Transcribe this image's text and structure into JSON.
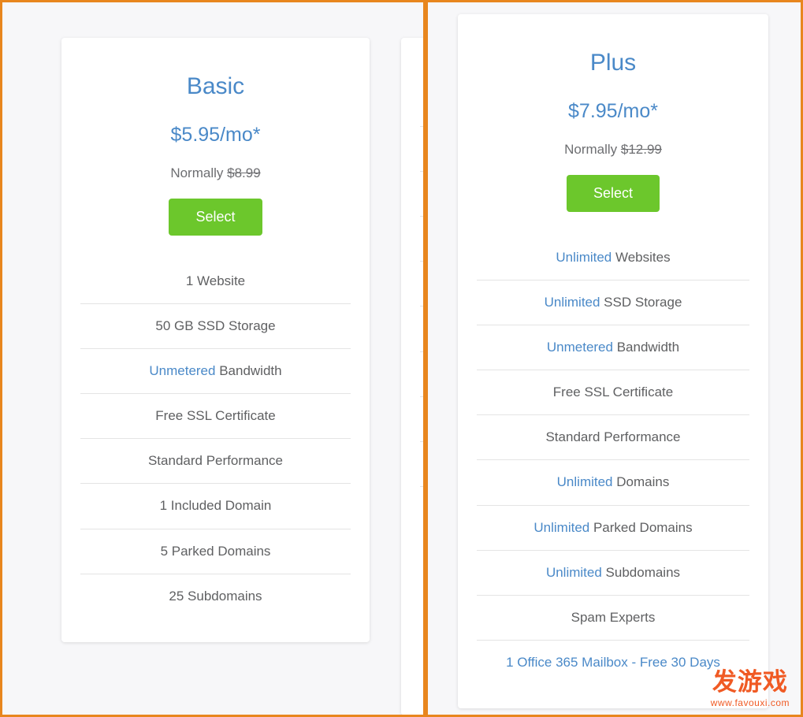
{
  "page": {
    "background_color": "#f7f7f9",
    "accent_blue": "#4a89c8",
    "accent_green": "#6cc72c",
    "highlight_border": "#e8861e"
  },
  "plans": [
    {
      "name": "Basic",
      "price": "$5.95/mo*",
      "normally_label": "Normally",
      "normally_price": "$8.99",
      "select_label": "Select",
      "features": [
        {
          "highlight": "",
          "text": "1 Website"
        },
        {
          "highlight": "",
          "text": "50 GB SSD Storage"
        },
        {
          "highlight": "Unmetered",
          "text": " Bandwidth"
        },
        {
          "highlight": "",
          "text": "Free SSL Certificate"
        },
        {
          "highlight": "",
          "text": "Standard Performance"
        },
        {
          "highlight": "",
          "text": "1 Included Domain"
        },
        {
          "highlight": "",
          "text": "5 Parked Domains"
        },
        {
          "highlight": "",
          "text": "25 Subdomains"
        }
      ]
    },
    {
      "name": "Plus",
      "price": "$7.95/mo*",
      "normally_label": "Normally",
      "normally_price": "$12.99",
      "select_label": "Select",
      "features": [
        {
          "highlight": "Unlimited",
          "text": " Websites"
        },
        {
          "highlight": "Unlimited",
          "text": " SSD Storage"
        },
        {
          "highlight": "Unmetered",
          "text": " Bandwidth"
        },
        {
          "highlight": "",
          "text": "Free SSL Certificate"
        },
        {
          "highlight": "",
          "text": "Standard Performance"
        },
        {
          "highlight": "Unlimited",
          "text": " Domains"
        },
        {
          "highlight": "Unlimited",
          "text": " Parked Domains"
        },
        {
          "highlight": "Unlimited",
          "text": " Subdomains"
        },
        {
          "highlight": "",
          "text": "Spam Experts"
        },
        {
          "highlight": "",
          "text": "1 Office 365 Mailbox - Free 30 Days",
          "link": true
        }
      ]
    }
  ],
  "watermark": {
    "main": "发游戏",
    "sub": "www.favouxi.com"
  }
}
